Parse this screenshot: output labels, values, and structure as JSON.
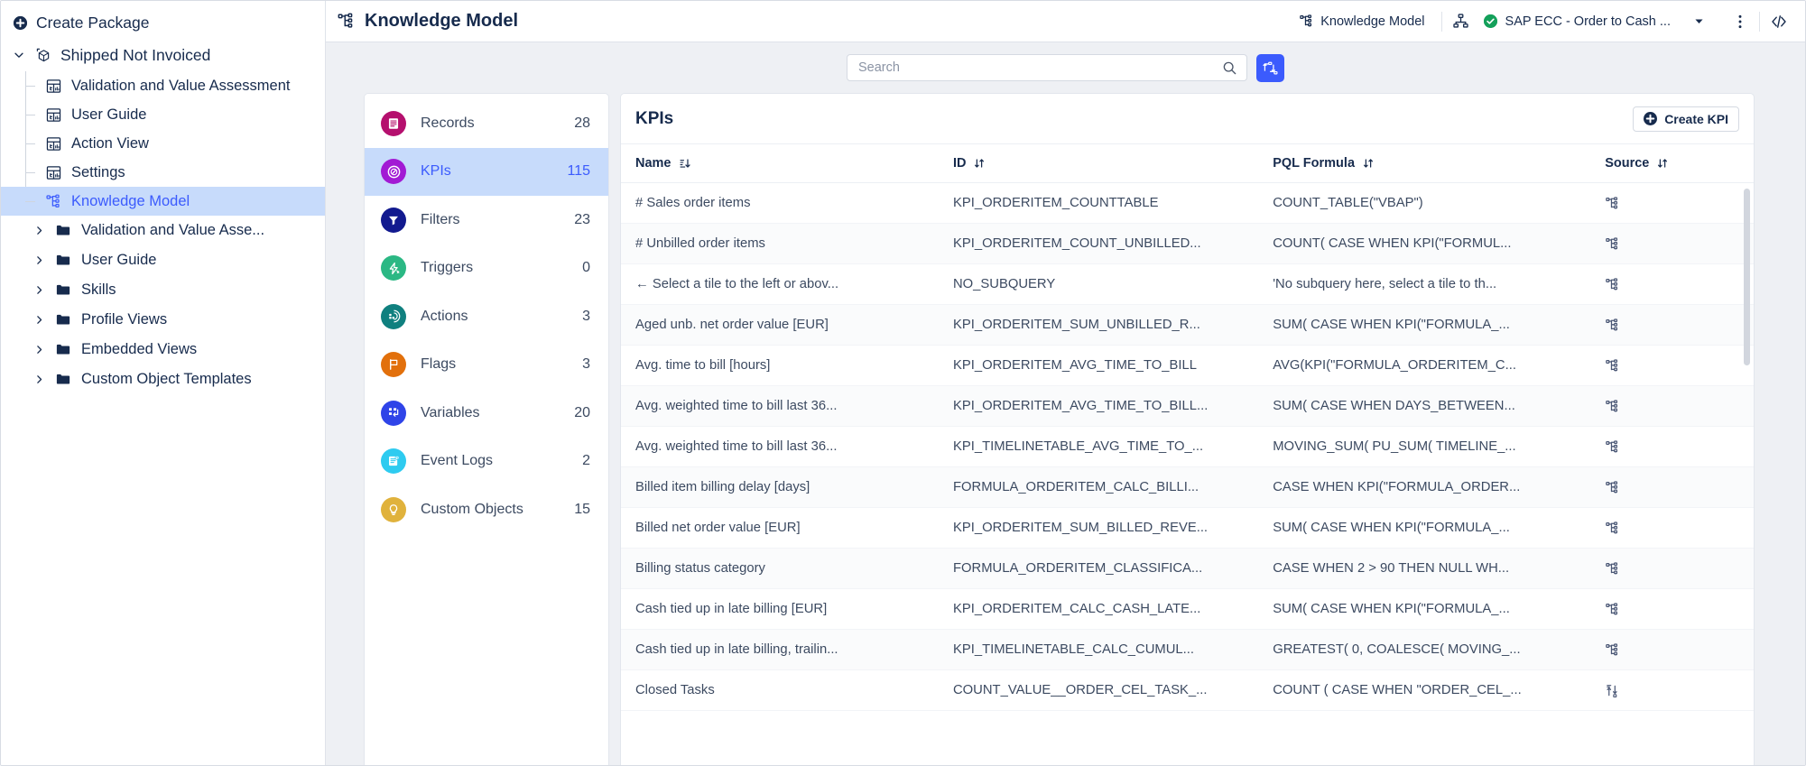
{
  "sidebar": {
    "create_package": "Create Package",
    "root": {
      "label": "Shipped Not Invoiced",
      "icon": "package-icon",
      "expanded": true
    },
    "views": [
      {
        "label": "Validation and Value Assessment",
        "icon": "view-icon"
      },
      {
        "label": "User Guide",
        "icon": "view-icon"
      },
      {
        "label": "Action View",
        "icon": "view-icon"
      },
      {
        "label": "Settings",
        "icon": "view-icon"
      },
      {
        "label": "Knowledge Model",
        "icon": "knowledge-model-icon",
        "selected": true
      }
    ],
    "folders": [
      {
        "label": "Validation and Value Asse...",
        "icon": "folder-icon"
      },
      {
        "label": "User Guide",
        "icon": "folder-icon"
      },
      {
        "label": "Skills",
        "icon": "folder-icon"
      },
      {
        "label": "Profile Views",
        "icon": "folder-icon"
      },
      {
        "label": "Embedded Views",
        "icon": "folder-icon"
      },
      {
        "label": "Custom Object Templates",
        "icon": "folder-icon"
      }
    ]
  },
  "topbar": {
    "title": "Knowledge Model",
    "title_icon": "knowledge-model-icon",
    "chip_knowledge_model": "Knowledge Model",
    "chip_knowledge_model_icon": "knowledge-model-icon",
    "data_model_icon": "data-model-icon",
    "datamodel_label": "SAP ECC - Order to Cash ...",
    "datamodel_status_icon": "green-check-icon",
    "chevron_icon": "chevron-down-icon",
    "more_icon": "kebab-menu-icon",
    "code_icon": "code-brackets-icon"
  },
  "search": {
    "placeholder": "Search",
    "value": "",
    "icon": "search-icon",
    "filter_button_icon": "hierarchy-filter-icon",
    "filter_button_color": "#3b5bfd"
  },
  "categories": [
    {
      "label": "Records",
      "count": "28",
      "icon": "records-icon",
      "color": "#b5106e",
      "active": false
    },
    {
      "label": "KPIs",
      "count": "115",
      "icon": "kpi-compass-icon",
      "color": "#a21ad4",
      "active": true
    },
    {
      "label": "Filters",
      "count": "23",
      "icon": "funnel-icon",
      "color": "#121a8f",
      "active": false
    },
    {
      "label": "Triggers",
      "count": "0",
      "icon": "trigger-icon",
      "color": "#2bb884",
      "active": false
    },
    {
      "label": "Actions",
      "count": "3",
      "icon": "actions-icon",
      "color": "#10807f",
      "active": false
    },
    {
      "label": "Flags",
      "count": "3",
      "icon": "flag-icon",
      "color": "#e2700c",
      "active": false
    },
    {
      "label": "Variables",
      "count": "20",
      "icon": "variables-icon",
      "color": "#2f44e8",
      "active": false
    },
    {
      "label": "Event Logs",
      "count": "2",
      "icon": "event-log-icon",
      "color": "#2ecbf0",
      "active": false
    },
    {
      "label": "Custom Objects",
      "count": "15",
      "icon": "bulb-icon",
      "color": "#e0b23c",
      "active": false
    }
  ],
  "table": {
    "panel_title": "KPIs",
    "create_button": "Create KPI",
    "create_button_icon": "plus-circle-icon",
    "columns": [
      {
        "label": "Name",
        "sort_icon": "sort-asc-icon"
      },
      {
        "label": "ID",
        "sort_icon": "sort-none-icon"
      },
      {
        "label": "PQL Formula",
        "sort_icon": "sort-none-icon"
      },
      {
        "label": "Source",
        "sort_icon": "sort-none-icon"
      }
    ],
    "rows": [
      {
        "name": "# Sales order items",
        "id": "KPI_ORDERITEM_COUNTTABLE",
        "pql": "COUNT_TABLE(\"VBAP\")",
        "source_icon": "knowledge-model-icon"
      },
      {
        "name": "# Unbilled order items",
        "id": "KPI_ORDERITEM_COUNT_UNBILLED...",
        "pql": "COUNT( CASE WHEN KPI(\"FORMUL...",
        "source_icon": "knowledge-model-icon"
      },
      {
        "name": "← Select a tile to the left or abov...",
        "id": "NO_SUBQUERY",
        "pql": "'No subquery here, select a tile to th...",
        "source_icon": "knowledge-model-icon"
      },
      {
        "name": "Aged unb. net order value [EUR]",
        "id": "KPI_ORDERITEM_SUM_UNBILLED_R...",
        "pql": "SUM( CASE WHEN KPI(\"FORMULA_...",
        "source_icon": "knowledge-model-icon"
      },
      {
        "name": "Avg. time to bill [hours]",
        "id": "KPI_ORDERITEM_AVG_TIME_TO_BILL",
        "pql": "AVG(KPI(\"FORMULA_ORDERITEM_C...",
        "source_icon": "knowledge-model-icon"
      },
      {
        "name": "Avg. weighted time to bill last 36...",
        "id": "KPI_ORDERITEM_AVG_TIME_TO_BILL...",
        "pql": "SUM( CASE WHEN DAYS_BETWEEN...",
        "source_icon": "knowledge-model-icon"
      },
      {
        "name": "Avg. weighted time to bill last 36...",
        "id": "KPI_TIMELINETABLE_AVG_TIME_TO_...",
        "pql": "MOVING_SUM( PU_SUM( TIMELINE_...",
        "source_icon": "knowledge-model-icon"
      },
      {
        "name": "Billed item billing delay [days]",
        "id": "FORMULA_ORDERITEM_CALC_BILLI...",
        "pql": "CASE WHEN KPI(\"FORMULA_ORDER...",
        "source_icon": "knowledge-model-icon"
      },
      {
        "name": "Billed net order value [EUR]",
        "id": "KPI_ORDERITEM_SUM_BILLED_REVE...",
        "pql": "SUM( CASE WHEN KPI(\"FORMULA_...",
        "source_icon": "knowledge-model-icon"
      },
      {
        "name": "Billing status category",
        "id": "FORMULA_ORDERITEM_CLASSIFICA...",
        "pql": "CASE WHEN 2 > 90 THEN NULL WH...",
        "source_icon": "knowledge-model-icon"
      },
      {
        "name": "Cash tied up in late billing [EUR]",
        "id": "KPI_ORDERITEM_CALC_CASH_LATE...",
        "pql": "SUM( CASE WHEN KPI(\"FORMULA_...",
        "source_icon": "knowledge-model-icon"
      },
      {
        "name": "Cash tied up in late billing, trailin...",
        "id": "KPI_TIMELINETABLE_CALC_CUMUL...",
        "pql": "GREATEST( 0, COALESCE( MOVING_...",
        "source_icon": "knowledge-model-icon"
      },
      {
        "name": "Closed Tasks",
        "id": "COUNT_VALUE__ORDER_CEL_TASK_...",
        "pql": "COUNT ( CASE WHEN \"ORDER_CEL_...",
        "source_icon": "transform-icon"
      }
    ]
  }
}
